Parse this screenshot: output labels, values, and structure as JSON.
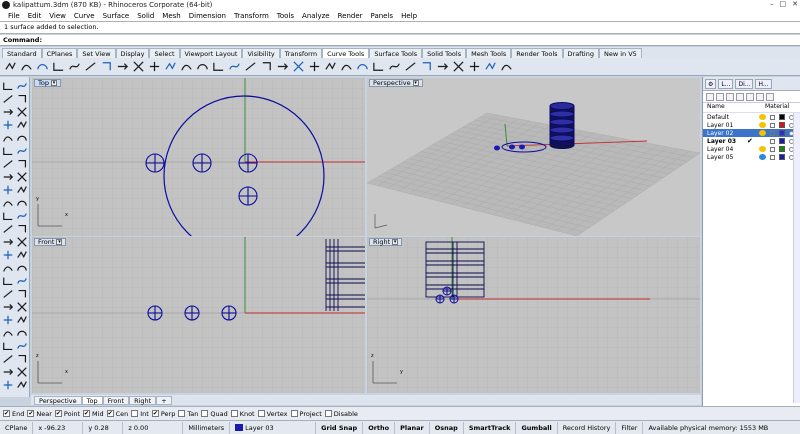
{
  "window": {
    "title": "kalipattum.3dm (870 KB) - Rhinoceros Corporate (64-bit)",
    "minimize": "–",
    "maximize": "□",
    "close": "✕"
  },
  "menu": [
    "File",
    "Edit",
    "View",
    "Curve",
    "Surface",
    "Solid",
    "Mesh",
    "Dimension",
    "Transform",
    "Tools",
    "Analyze",
    "Render",
    "Panels",
    "Help"
  ],
  "history": {
    "line1": "1 surface added to selection."
  },
  "command": {
    "label": "Command:",
    "value": ""
  },
  "toolbar_tabs": [
    "Standard",
    "CPlanes",
    "Set View",
    "Display",
    "Select",
    "Viewport Layout",
    "Visibility",
    "Transform",
    "Curve Tools",
    "Surface Tools",
    "Solid Tools",
    "Mesh Tools",
    "Render Tools",
    "Drafting",
    "New in V5"
  ],
  "active_toolbar_tab": "Curve Tools",
  "toolbar_icons": [
    "polyline-icon",
    "curve-icon",
    "arc-icon",
    "fillet-icon",
    "blend-icon",
    "chamfer-icon",
    "offset-icon",
    "extend-icon",
    "trim-icon",
    "split-icon",
    "join-icon",
    "explode-icon",
    "rebuild-icon",
    "fit-icon",
    "dir-icon",
    "seam-icon",
    "match-icon",
    "symmetry-icon",
    "project-icon",
    "pull-icon",
    "control-points-icon",
    "edit-points-icon",
    "insert-knot-icon",
    "remove-knot-icon",
    "circle-icon",
    "ellipse-icon",
    "polygon-icon",
    "rectangle-icon",
    "text-icon",
    "hatch-icon",
    "dimension-icon",
    "leader-icon"
  ],
  "viewports": {
    "top": {
      "label": "Top"
    },
    "perspective": {
      "label": "Perspective"
    },
    "front": {
      "label": "Front"
    },
    "right": {
      "label": "Right"
    }
  },
  "viewport_tabs": [
    "Perspective",
    "Top",
    "Front",
    "Right",
    "+"
  ],
  "active_viewport_tab": "Top",
  "axis_labels": {
    "x": "x",
    "y": "y",
    "z": "z"
  },
  "osnaps": [
    {
      "label": "End",
      "checked": true
    },
    {
      "label": "Near",
      "checked": true
    },
    {
      "label": "Point",
      "checked": true
    },
    {
      "label": "Mid",
      "checked": true
    },
    {
      "label": "Cen",
      "checked": true
    },
    {
      "label": "Int",
      "checked": false
    },
    {
      "label": "Perp",
      "checked": true
    },
    {
      "label": "Tan",
      "checked": false
    },
    {
      "label": "Quad",
      "checked": false
    },
    {
      "label": "Knot",
      "checked": false
    },
    {
      "label": "Vertex",
      "checked": false
    },
    {
      "label": "Project",
      "checked": false
    },
    {
      "label": "Disable",
      "checked": false
    }
  ],
  "status": {
    "cplane": "CPlane",
    "x": "x -96.23",
    "y": "y 0.28",
    "z": "z 0.00",
    "units": "Millimeters",
    "layer": "Layer 03",
    "grid_snap": "Grid Snap",
    "ortho": "Ortho",
    "planar": "Planar",
    "osnap": "Osnap",
    "smarttrack": "SmartTrack",
    "gumball": "Gumball",
    "record_history": "Record History",
    "filter": "Filter",
    "memory": "Available physical memory: 1553 MB"
  },
  "panel": {
    "tabs": [
      "L...",
      "Di...",
      "H..."
    ],
    "header_name": "Name",
    "header_material": "Material",
    "layers": [
      {
        "name": "Default",
        "color": "#000000",
        "bulb": "#f2c400",
        "selected": false,
        "current": false,
        "check": ""
      },
      {
        "name": "Layer 01",
        "color": "#d11",
        "bulb": "#f2c400",
        "selected": false,
        "current": false,
        "check": ""
      },
      {
        "name": "Layer 02",
        "color": "#2a2ad6",
        "bulb": "#f2c400",
        "selected": true,
        "current": false,
        "check": ""
      },
      {
        "name": "Layer 03",
        "color": "#1a1ab3",
        "bulb": "",
        "selected": false,
        "current": true,
        "check": "✔"
      },
      {
        "name": "Layer 04",
        "color": "#118a11",
        "bulb": "#f2c400",
        "selected": false,
        "current": false,
        "check": ""
      },
      {
        "name": "Layer 05",
        "color": "#1a1ab3",
        "bulb": "#2a8ad6",
        "selected": false,
        "current": false,
        "check": ""
      }
    ]
  },
  "colors": {
    "grid": "#b4b4b4",
    "grid_major": "#a0a0a0",
    "curve": "#0a0a9e",
    "x_axis": "#c0282b",
    "y_axis": "#2a8a2a",
    "selection": "#3b74c9"
  }
}
